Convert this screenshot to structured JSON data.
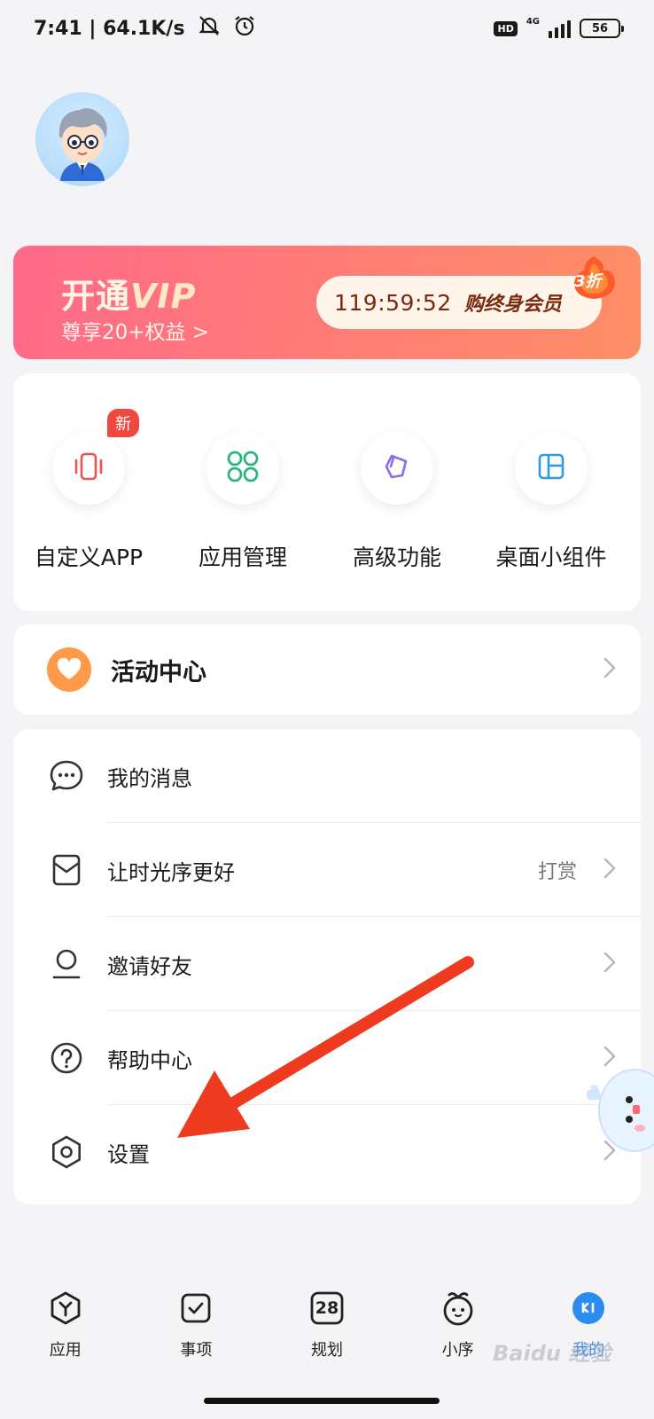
{
  "status_bar": {
    "time_speed": "7:41 | 64.1K/s",
    "hd": "HD",
    "network": "4G",
    "battery": "56"
  },
  "vip_banner": {
    "title_prefix": "开通",
    "title_vip": "VIP",
    "subtitle": "尊享20+权益 >",
    "countdown": "119:59:52",
    "cta": "购终身会员",
    "discount": "3折"
  },
  "tools": [
    {
      "label": "自定义APP",
      "icon": "phone-vibrate-icon",
      "badge": "新"
    },
    {
      "label": "应用管理",
      "icon": "apps-grid-icon"
    },
    {
      "label": "高级功能",
      "icon": "pen-nib-icon"
    },
    {
      "label": "桌面小组件",
      "icon": "widget-layout-icon"
    }
  ],
  "activity": {
    "label": "活动中心",
    "icon": "heart-icon"
  },
  "menu": [
    {
      "label": "我的消息",
      "icon": "chat-bubble-icon"
    },
    {
      "label": "让时光序更好",
      "icon": "gift-box-icon",
      "extra": "打赏"
    },
    {
      "label": "邀请好友",
      "icon": "person-icon"
    },
    {
      "label": "帮助中心",
      "icon": "help-icon"
    },
    {
      "label": "设置",
      "icon": "gear-icon"
    }
  ],
  "bottom_nav": [
    {
      "label": "应用",
      "icon": "app-hex-icon"
    },
    {
      "label": "事项",
      "icon": "check-square-icon"
    },
    {
      "label": "规划",
      "icon": "calendar-icon",
      "number": "28"
    },
    {
      "label": "小序",
      "icon": "mascot-icon"
    },
    {
      "label": "我的",
      "icon": "profile-icon",
      "active": true
    }
  ],
  "watermark": "Baidu 经验",
  "colors": {
    "accent": "#2a8cf0",
    "banner_start": "#ff6a8a",
    "banner_end": "#ff8f66",
    "badge_red": "#f0483e",
    "arrow_red": "#ee3a1f"
  }
}
